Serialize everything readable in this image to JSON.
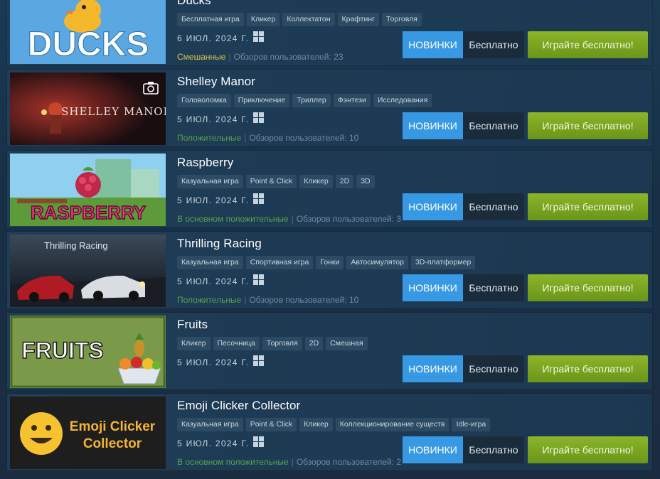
{
  "games": [
    {
      "title": "Ducks",
      "thumb_text": "DUCKS",
      "tags": [
        "Бесплатная игра",
        "Кликер",
        "Коллектатон",
        "Крафтинг",
        "Торговля"
      ],
      "date": "6 ИЮЛ. 2024 Г.",
      "review_label": "Смешанные",
      "review_class": "mixed",
      "review_count": "Обзоров пользователей: 23"
    },
    {
      "title": "Shelley Manor",
      "thumb_text": "SHELLEY MANOR",
      "tags": [
        "Головоломка",
        "Приключение",
        "Триллер",
        "Фэнтези",
        "Исследования"
      ],
      "date": "5 ИЮЛ. 2024 Г.",
      "review_label": "Положительные",
      "review_class": "pos",
      "review_count": "Обзоров пользователей: 10"
    },
    {
      "title": "Raspberry",
      "thumb_text": "RASPBERRY",
      "tags": [
        "Казуальная игра",
        "Point & Click",
        "Кликер",
        "2D",
        "3D"
      ],
      "date": "5 ИЮЛ. 2024 Г.",
      "review_label": "В основном положительные",
      "review_class": "pos",
      "review_count": "Обзоров пользователей: 3"
    },
    {
      "title": "Thrilling Racing",
      "thumb_text": "Thrilling Racing",
      "tags": [
        "Казуальная игра",
        "Спортивная игра",
        "Гонки",
        "Автосимулятор",
        "3D-платформер"
      ],
      "date": "5 ИЮЛ. 2024 Г.",
      "review_label": "Положительные",
      "review_class": "pos",
      "review_count": "Обзоров пользователей: 10"
    },
    {
      "title": "Fruits",
      "thumb_text": "FRUITS",
      "tags": [
        "Кликер",
        "Песочница",
        "Торговля",
        "2D",
        "Смешная"
      ],
      "date": "5 ИЮЛ. 2024 Г.",
      "review_label": "",
      "review_class": "",
      "review_count": ""
    },
    {
      "title": "Emoji Clicker Collector",
      "thumb_text": "Emoji Clicker Collector",
      "tags": [
        "Казуальная игра",
        "Point & Click",
        "Кликер",
        "Коллекционирование существ",
        "Idle-игра"
      ],
      "date": "5 ИЮЛ. 2024 Г.",
      "review_label": "В основном положительные",
      "review_class": "pos",
      "review_count": "Обзоров пользователей: 2"
    }
  ],
  "labels": {
    "new": "НОВИНКИ",
    "free": "Бесплатно",
    "play": "Играйте бесплатно!"
  },
  "colors": {
    "new_badge": "#3799e3",
    "play_button": "#7aa51f",
    "mixed_review": "#d8c34e",
    "positive_review": "#56a14e"
  },
  "icons": {
    "platform": "windows-icon",
    "screenshot": "camera-icon"
  }
}
